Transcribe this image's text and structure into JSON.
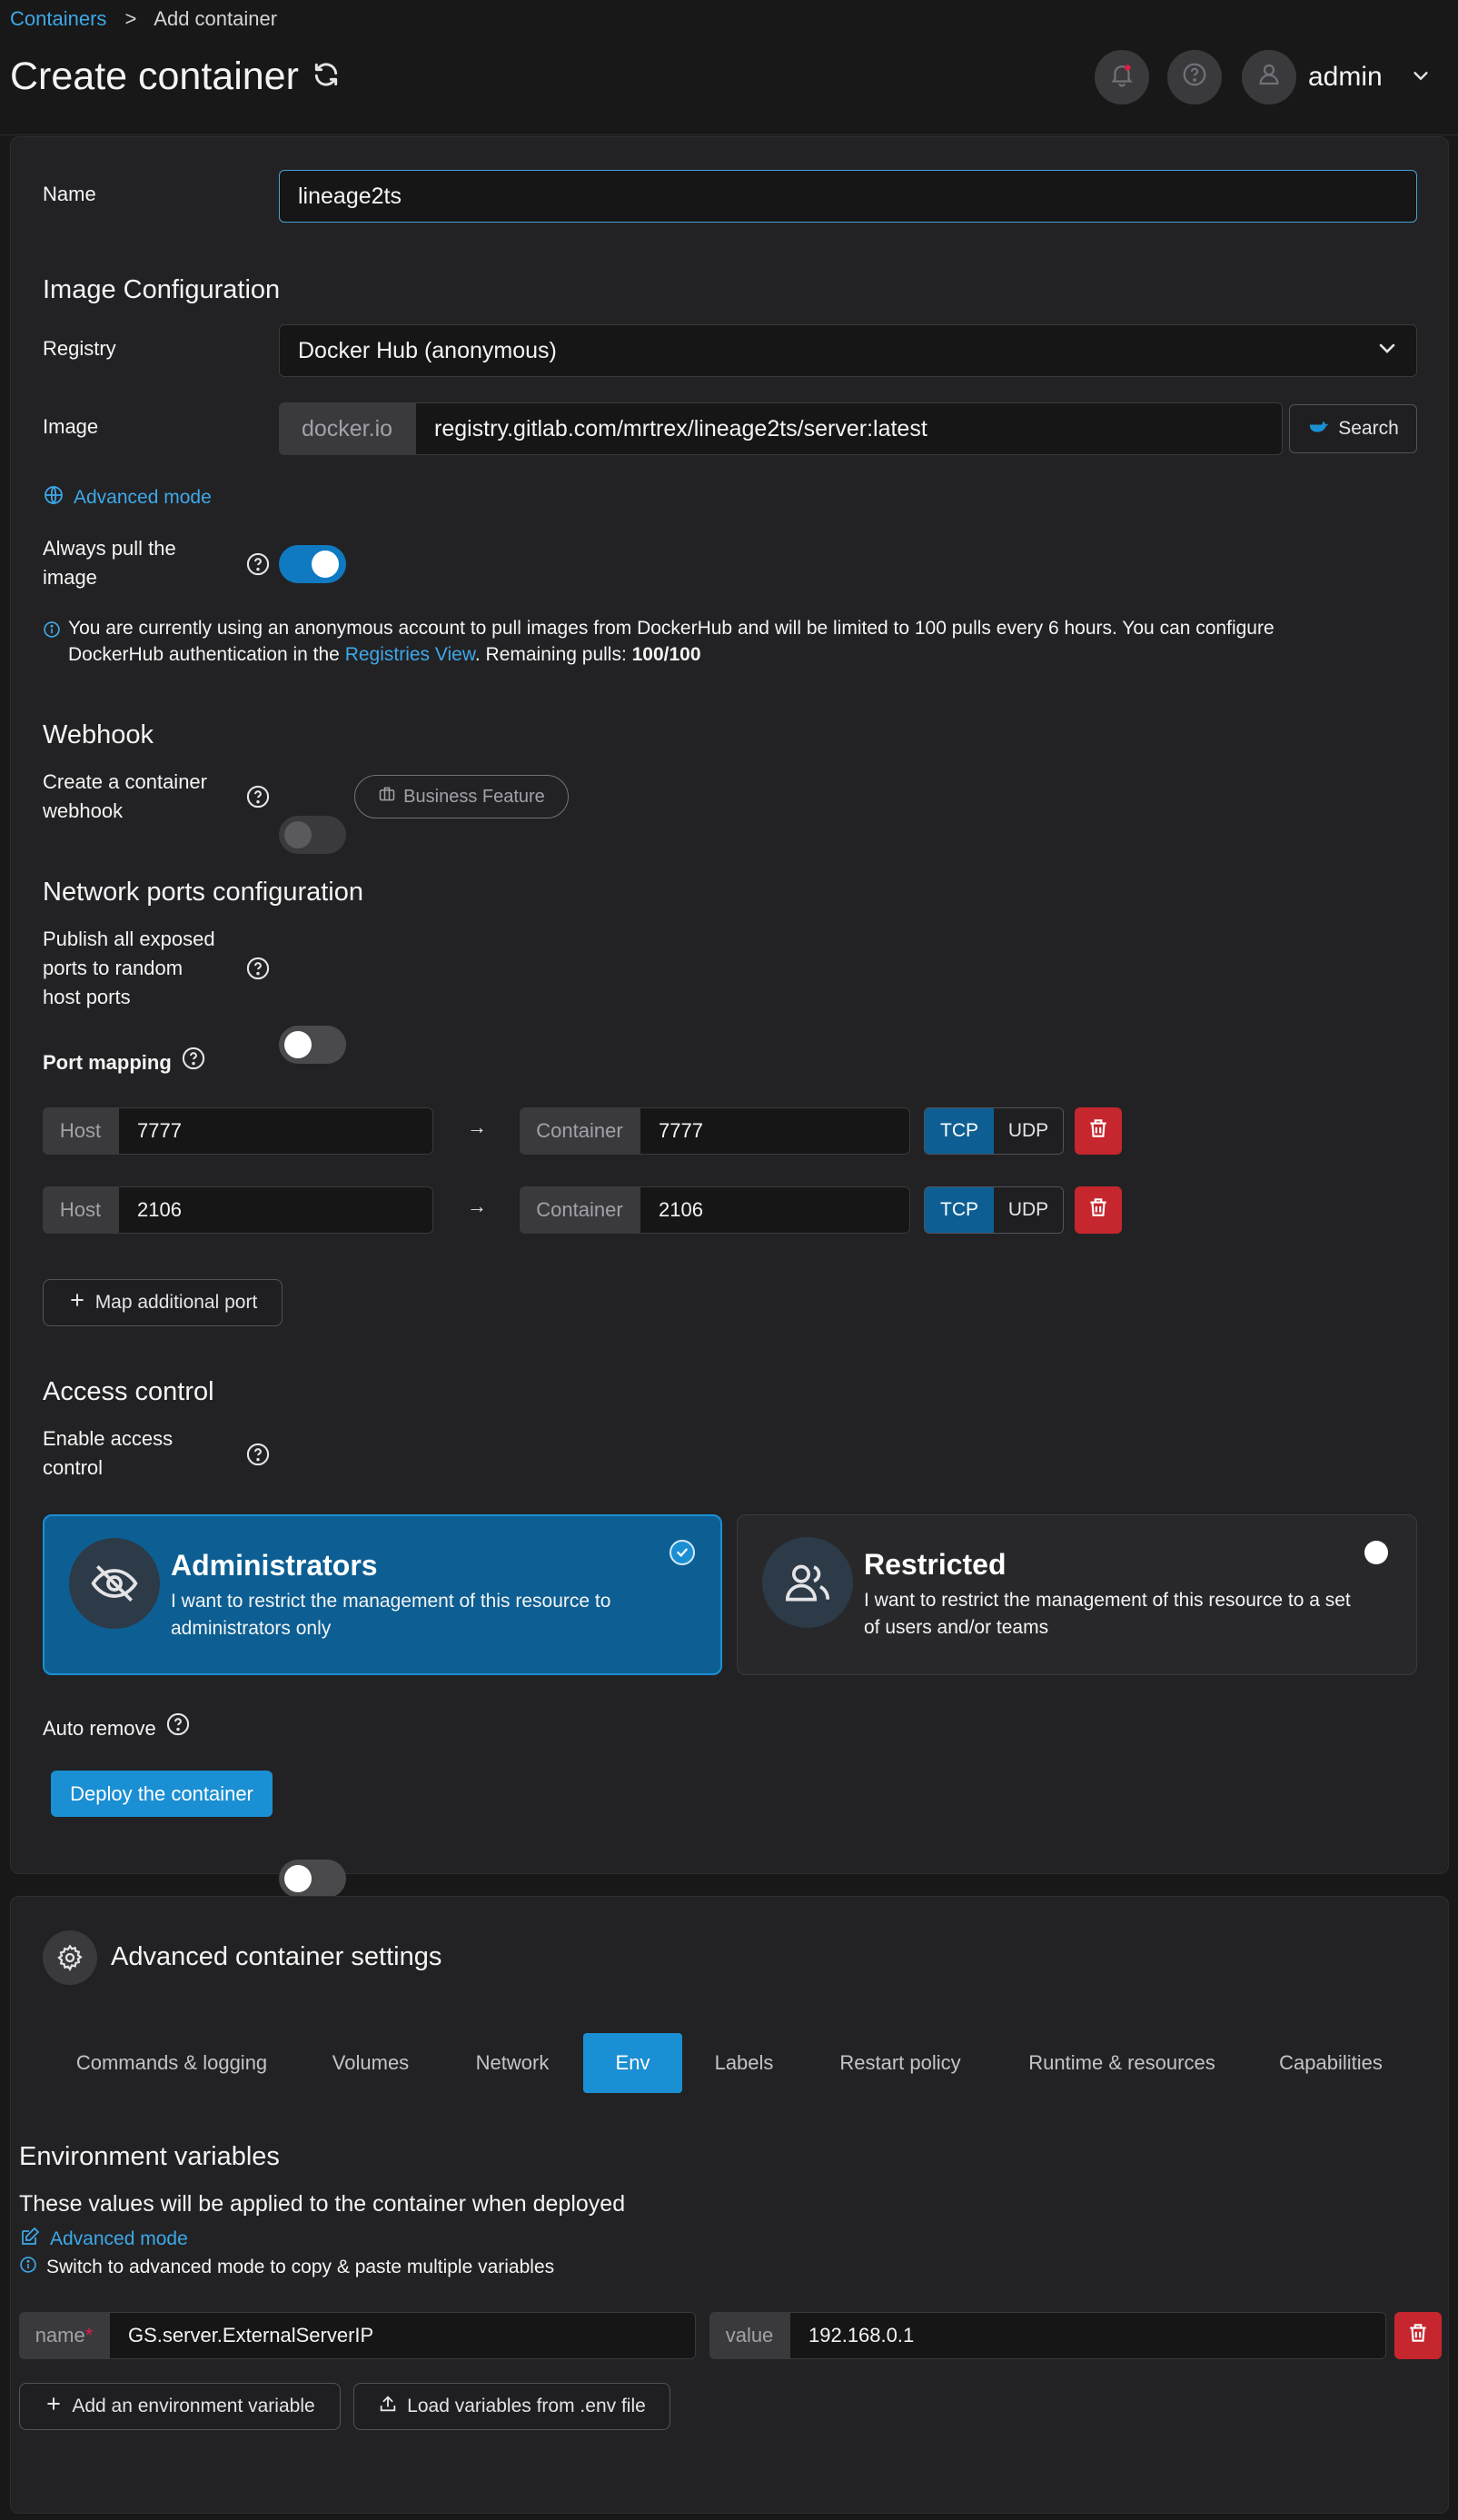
{
  "breadcrumb": {
    "root": "Containers",
    "separator": ">",
    "current": "Add container"
  },
  "header": {
    "title": "Create container",
    "user": "admin"
  },
  "form": {
    "name_label": "Name",
    "name_value": "lineage2ts",
    "image_config_title": "Image Configuration",
    "registry_label": "Registry",
    "registry_value": "Docker Hub (anonymous)",
    "image_label": "Image",
    "image_prefix": "docker.io",
    "image_value": "registry.gitlab.com/mrtrex/lineage2ts/server:latest",
    "search_label": "Search",
    "advanced_mode": "Advanced mode",
    "always_pull_label_1": "Always pull the",
    "always_pull_label_2": "image",
    "always_pull": true,
    "dockerhub_info_1": "You are currently using an anonymous account to pull images from DockerHub and will be limited to 100 pulls every 6 hours. You can configure",
    "dockerhub_info_2a": "DockerHub authentication in the ",
    "dockerhub_info_link": "Registries View",
    "dockerhub_info_2b": ". Remaining pulls: ",
    "dockerhub_info_pulls": "100/100"
  },
  "webhook": {
    "title": "Webhook",
    "label_1": "Create a container",
    "label_2": "webhook",
    "enabled": false,
    "badge": "Business Feature"
  },
  "network": {
    "title": "Network ports configuration",
    "publish_label_1": "Publish all exposed",
    "publish_label_2": "ports to random",
    "publish_label_3": "host ports",
    "publish_all": false,
    "port_mapping_label": "Port mapping",
    "host_label": "Host",
    "container_label": "Container",
    "arrow": "→",
    "ports": [
      {
        "host": "7777",
        "container": "7777",
        "tcp": "TCP",
        "udp": "UDP",
        "selected": "TCP"
      },
      {
        "host": "2106",
        "container": "2106",
        "tcp": "TCP",
        "udp": "UDP",
        "selected": "TCP"
      }
    ],
    "map_additional": "Map additional port"
  },
  "access": {
    "title": "Access control",
    "enable_label_1": "Enable access",
    "enable_label_2": "control",
    "enabled": true,
    "admin_title": "Administrators",
    "admin_desc_1": "I want to restrict the management of this resource to",
    "admin_desc_2": "administrators only",
    "restricted_title": "Restricted",
    "restricted_desc_1": "I want to restrict the management of this resource to a set",
    "restricted_desc_2": "of users and/or teams",
    "selected": "Administrators"
  },
  "auto_remove": {
    "label": "Auto remove",
    "enabled": false
  },
  "deploy_label": "Deploy the container",
  "advanced": {
    "title": "Advanced container settings",
    "tabs": [
      "Commands & logging",
      "Volumes",
      "Network",
      "Env",
      "Labels",
      "Restart policy",
      "Runtime & resources",
      "Capabilities"
    ],
    "active_tab": "Env"
  },
  "env": {
    "title": "Environment variables",
    "subtitle": "These values will be applied to the container when deployed",
    "advanced_mode": "Advanced mode",
    "hint": "Switch to advanced mode to copy & paste multiple variables",
    "name_label": "name",
    "required_mark": "*",
    "value_label": "value",
    "vars": [
      {
        "name": "GS.server.ExternalServerIP",
        "value": "192.168.0.1"
      }
    ],
    "add_button": "Add an environment variable",
    "load_button": "Load variables from .env file"
  },
  "colors": {
    "accent": "#1b8fd3",
    "link": "#3ea8e8",
    "danger": "#c6262e",
    "background": "#181818"
  }
}
